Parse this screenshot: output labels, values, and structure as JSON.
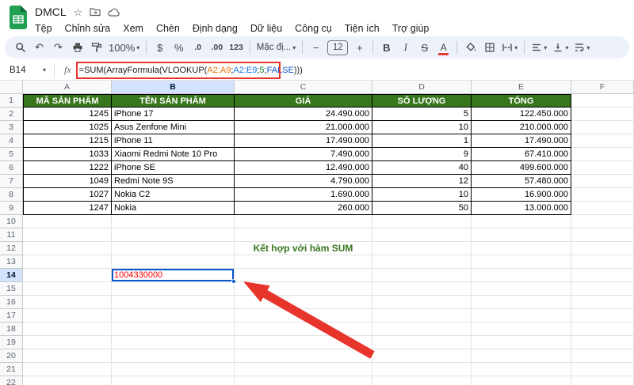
{
  "titlebar": {
    "doc_title": "DMCL",
    "menus": [
      "Tệp",
      "Chỉnh sửa",
      "Xem",
      "Chèn",
      "Định dạng",
      "Dữ liệu",
      "Công cụ",
      "Tiện ích",
      "Trợ giúp"
    ]
  },
  "toolbar": {
    "undo_glyph": "↶",
    "redo_glyph": "↷",
    "zoom": "100%",
    "currency": "$",
    "percent": "%",
    "decimal_decrease": ".0",
    "decimal_increase": ".00",
    "number_format": "123",
    "font_name": "Mặc đị...",
    "minus": "−",
    "font_size": "12",
    "plus": "+",
    "bold": "B",
    "italic": "I",
    "strikethrough": "S",
    "text_color": "A",
    "icons": [
      "search-icon",
      "undo-icon",
      "redo-icon",
      "print-icon",
      "paint-format-icon",
      "fill-color-icon",
      "borders-icon",
      "merge-cells-icon",
      "horizontal-align-icon",
      "vertical-align-icon",
      "text-wrap-icon"
    ]
  },
  "formula_bar": {
    "cell_ref": "B14",
    "fx_label": "fx",
    "parts": [
      {
        "t": "=SUM(ArrayFormula(VLOOKUP(",
        "c": "#202124"
      },
      {
        "t": "A2:A9",
        "c": "#e8710a"
      },
      {
        "t": ";",
        "c": "#202124"
      },
      {
        "t": "A2:E9",
        "c": "#1a73e8"
      },
      {
        "t": ";",
        "c": "#202124"
      },
      {
        "t": "5",
        "c": "#188038"
      },
      {
        "t": ";",
        "c": "#202124"
      },
      {
        "t": "FALSE",
        "c": "#1155cb"
      },
      {
        "t": ")))",
        "c": "#202124"
      }
    ]
  },
  "grid": {
    "columns": [
      "A",
      "B",
      "C",
      "D",
      "E",
      "F"
    ],
    "row_count": 22,
    "selected_column": "B",
    "selected_row": 14,
    "table": {
      "start_cell": "A1",
      "header": [
        "MÃ SẢN PHẨM",
        "TÊN SẢN PHẨM",
        "GIÁ",
        "SỐ LƯỢNG",
        "TỔNG"
      ],
      "header_bg": "#38761d",
      "header_text_color": "#ffffff",
      "rows": [
        [
          "1245",
          "iPhone 17",
          "24.490.000",
          "5",
          "122.450.000"
        ],
        [
          "1025",
          "Asus Zenfone Mini",
          "21.000.000",
          "10",
          "210.000.000"
        ],
        [
          "1215",
          "iPhone 11",
          "17.490.000",
          "1",
          "17.490.000"
        ],
        [
          "1033",
          "Xiaomi Redmi Note 10 Pro",
          "7.490.000",
          "9",
          "67.410.000"
        ],
        [
          "1222",
          "iPhone SE",
          "12.490.000",
          "40",
          "499.600.000"
        ],
        [
          "1049",
          "Redmi Note 9S",
          "4.790.000",
          "12",
          "57.480.000"
        ],
        [
          "1027",
          "Nokia C2",
          "1.690.000",
          "10",
          "16.900.000"
        ],
        [
          "1247",
          "Nokia",
          "260.000",
          "50",
          "13.000.000"
        ]
      ]
    },
    "note": {
      "cell": "C12",
      "text": "Kết hợp với hàm SUM",
      "color": "#38761d"
    },
    "selection": {
      "cell": "B14",
      "value": "1004330000",
      "value_color": "#ff0000",
      "border_color": "#0b57d0"
    }
  },
  "annotations": {
    "color": "#e8352c"
  }
}
